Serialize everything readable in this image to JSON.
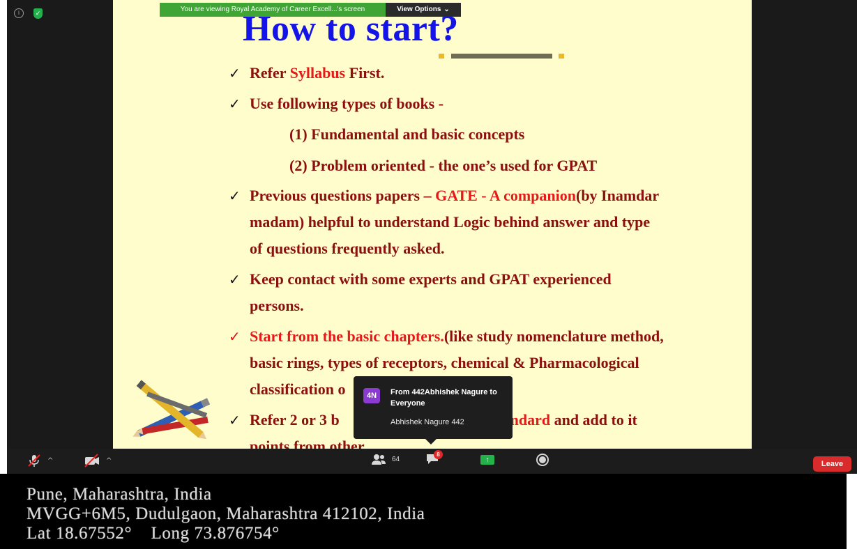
{
  "share_banner": {
    "text": "You are viewing Royal Academy of Career Excell...'s screen",
    "view_options": "View Options"
  },
  "slide": {
    "title": "How to start?",
    "bullets": [
      {
        "parts": [
          "Refer ",
          "Syllabus",
          " First."
        ]
      },
      {
        "text": "Use following types of books -"
      },
      {
        "text": "(1) Fundamental and basic concepts"
      },
      {
        "text": "(2) Problem oriented - the one’s used for GPAT"
      },
      {
        "line1_parts": [
          "Previous questions papers – ",
          "GATE - A companion",
          "(by Inamdar"
        ],
        "line2": "madam) helpful to understand Logic behind answer and type",
        "line3": "of questions frequently asked."
      },
      {
        "line1": "Keep contact with some experts and GPAT experienced",
        "line2": "persons."
      },
      {
        "line1_parts": [
          "Start from the basic chapters.",
          "(like study nomenclature method,"
        ],
        "line2": "basic rings, types of receptors, chemical & Pharmacological",
        "line3": "classification o"
      },
      {
        "line1_parts": [
          "Refer 2 or 3 b",
          "standard",
          " and add to it"
        ],
        "line2": "points from other"
      }
    ]
  },
  "chat_popup": {
    "avatar": "4N",
    "from": "From 442Abhishek Nagure to Everyone",
    "message": "Abhishek Nagure 442"
  },
  "toolbar": {
    "participants_count": "64",
    "chat_badge": "8",
    "leave_label": "Leave"
  },
  "geotag": {
    "line1": "Pune, Maharashtra, India",
    "line2": "MVGG+6M5, Dudulgaon, Maharashtra 412102, India",
    "line3": "Lat 18.67552°    Long 73.876754°"
  }
}
